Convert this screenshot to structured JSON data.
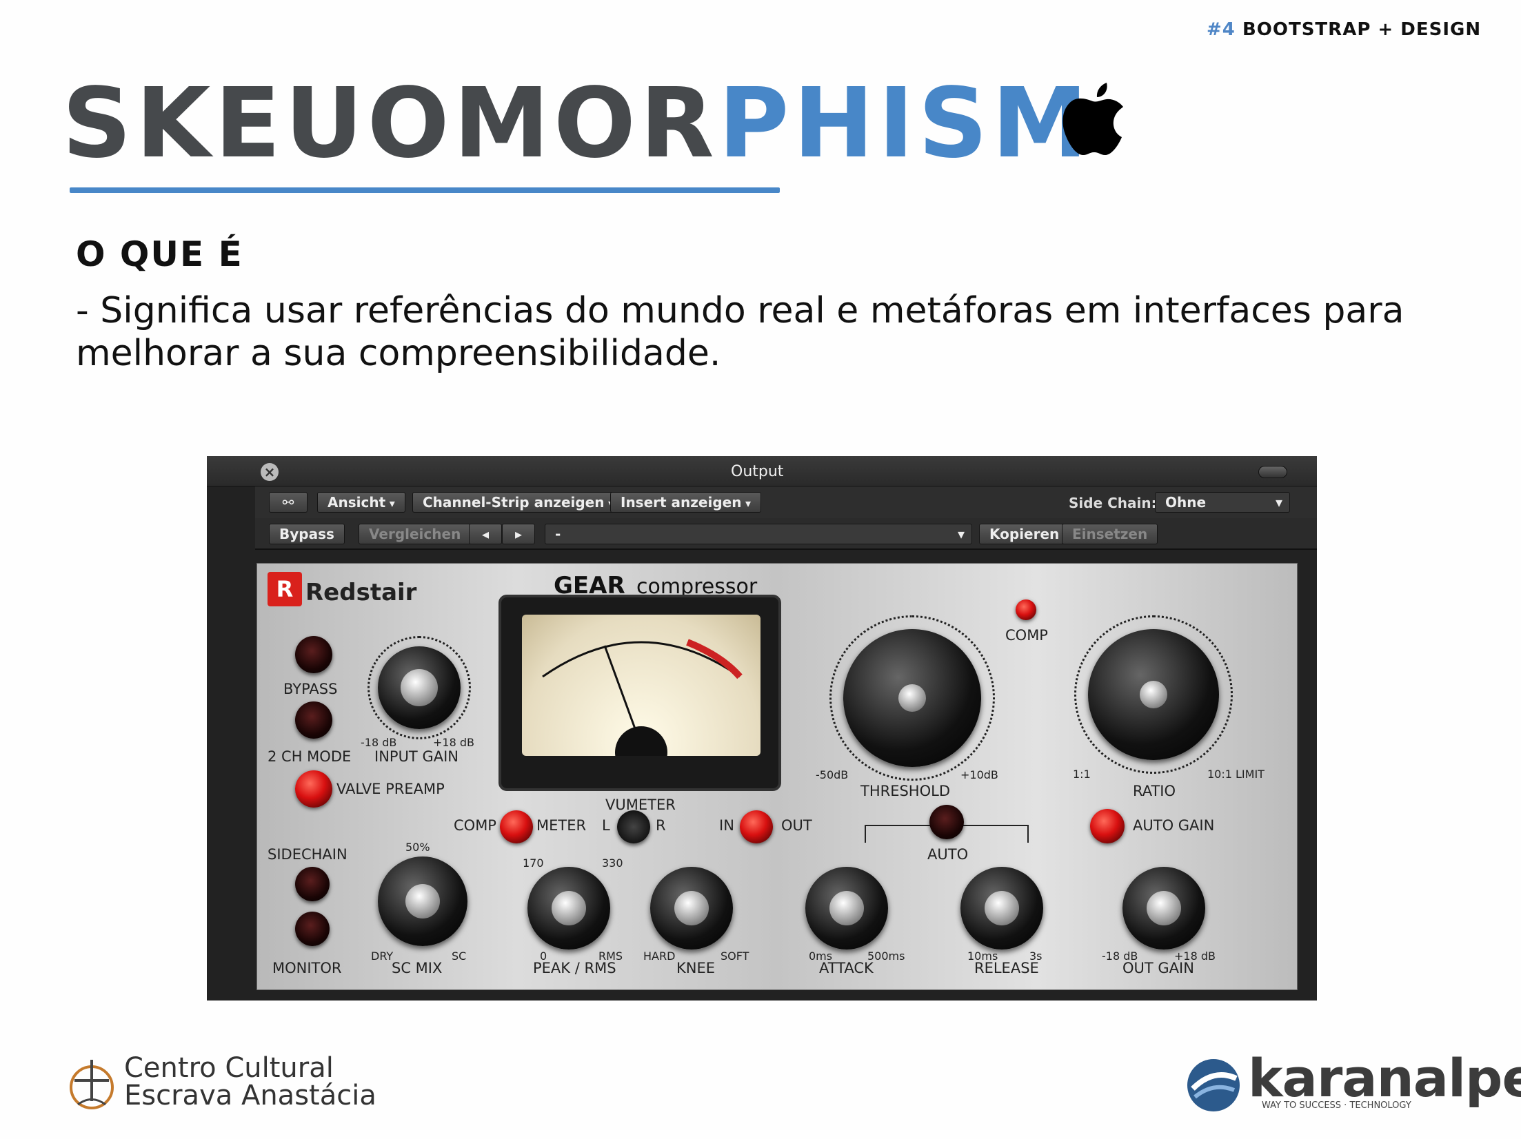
{
  "header": {
    "tag_number": "#4",
    "tag_text": "BOOTSTRAP + DESIGN"
  },
  "title": {
    "part1": "SKEUOMOR",
    "part2": "PHISM"
  },
  "section": {
    "heading": "O QUE É",
    "paragraph": "- Significa usar referências do mundo real e metáforas em interfaces para melhorar a sua compreensibilidade."
  },
  "plugin": {
    "window_title": "Output",
    "toolbar1": {
      "view": "Ansicht",
      "channel_strip": "Channel-Strip anzeigen",
      "insert": "Insert anzeigen",
      "sidechain_label": "Side Chain:",
      "sidechain_value": "Ohne"
    },
    "toolbar2": {
      "bypass": "Bypass",
      "compare": "Vergleichen",
      "preset": "-",
      "copy": "Kopieren",
      "paste": "Einsetzen"
    },
    "brand": "Redstair",
    "product_gear": "GEAR",
    "product_name": "compressor",
    "labels": {
      "bypass": "BYPASS",
      "ch_mode": "2 CH MODE",
      "input_gain": "INPUT GAIN",
      "valve_preamp": "VALVE PREAMP",
      "vumeter": "VUMETER",
      "comp": "COMP",
      "meter": "METER",
      "l": "L",
      "r": "R",
      "in": "IN",
      "out": "OUT",
      "threshold": "THRESHOLD",
      "comp_led": "COMP",
      "ratio": "RATIO",
      "auto_gain": "AUTO GAIN",
      "auto": "AUTO",
      "sidechain": "SIDECHAIN",
      "monitor": "MONITOR",
      "sc_mix": "SC MIX",
      "sc_mix_top": "50%",
      "dry": "DRY",
      "sc": "SC",
      "peak_rms": "PEAK / RMS",
      "knee": "KNEE",
      "hard": "HARD",
      "soft": "SOFT",
      "attack": "ATTACK",
      "release": "RELEASE",
      "out_gain": "OUT GAIN",
      "db_min": "-18 dB",
      "db_max": "+18 dB",
      "thr_min": "-50dB",
      "thr_max": "+10dB",
      "ratio_min": "1:1",
      "ratio_max": "10:1 LIMIT",
      "pr_170": "170",
      "pr_330": "330",
      "pr_0": "0",
      "pr_rms": "RMS",
      "att_0": "0ms",
      "att_500": "500ms",
      "rel_10": "10ms",
      "rel_3": "3s"
    }
  },
  "footer": {
    "org_line1": "Centro Cultural",
    "org_line2": "Escrava Anastácia",
    "brand": "karanalpe",
    "brand_sub": "WAY TO SUCCESS · TECHNOLOGY"
  }
}
